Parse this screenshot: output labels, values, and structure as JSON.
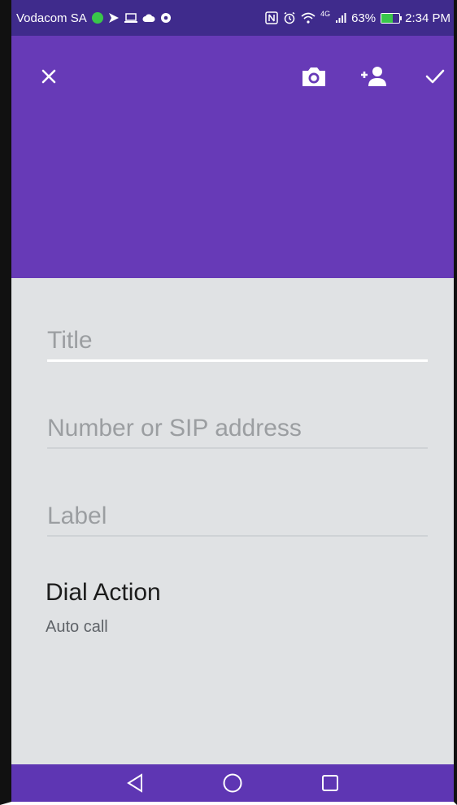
{
  "status_bar": {
    "carrier": "Vodacom SA",
    "network": "4G",
    "battery_percent": "63%",
    "time": "2:34 PM",
    "battery_level": 0.63
  },
  "toolbar": {
    "close_icon": "close-icon",
    "camera_icon": "camera-icon",
    "add_contact_icon": "add-person-icon",
    "save_icon": "check-icon"
  },
  "form": {
    "title_placeholder": "Title",
    "number_placeholder": "Number or SIP address",
    "label_placeholder": "Label"
  },
  "dial_action": {
    "title": "Dial Action",
    "value": "Auto call"
  },
  "colors": {
    "primary": "#673ab7",
    "status_bar": "#3f2b8c",
    "nav_bar": "#5e36b3",
    "background": "#e0e2e4"
  }
}
